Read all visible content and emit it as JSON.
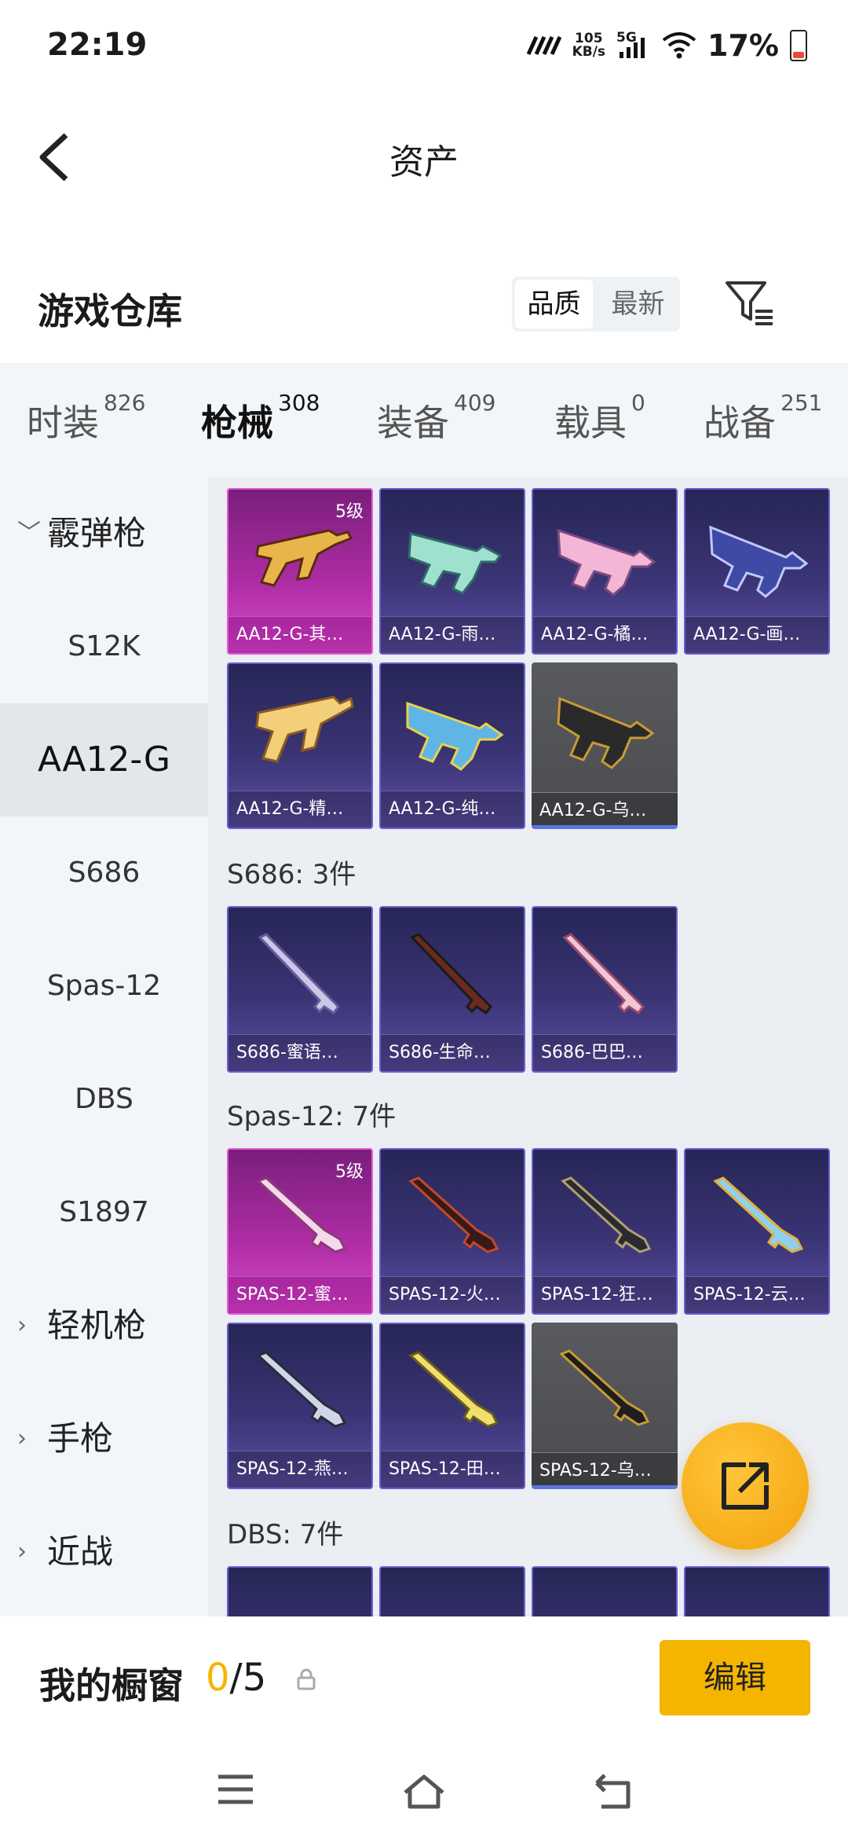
{
  "status": {
    "time": "22:19",
    "speed_value": "105",
    "speed_unit": "KB/s",
    "network": "5G",
    "battery": "17%"
  },
  "nav": {
    "title": "资产"
  },
  "warehouse": {
    "title": "游戏仓库",
    "sort_options": [
      "品质",
      "最新"
    ],
    "sort_selected": "品质"
  },
  "tabs": [
    {
      "label": "时装",
      "count": "826"
    },
    {
      "label": "枪械",
      "count": "308",
      "active": true
    },
    {
      "label": "装备",
      "count": "409"
    },
    {
      "label": "载具",
      "count": "0"
    },
    {
      "label": "战备",
      "count": "251"
    }
  ],
  "sidebar": {
    "groups": [
      "霰弹枪",
      "轻机枪",
      "手枪",
      "近战"
    ],
    "items": [
      "S12K",
      "AA12-G",
      "S686",
      "Spas-12",
      "DBS",
      "S1897"
    ],
    "selected": "AA12-G"
  },
  "sections": {
    "aa12": {
      "cards": [
        {
          "name": "AA12-G-其…",
          "level": "5级",
          "rarity": "legend"
        },
        {
          "name": "AA12-G-雨…",
          "rarity": "epic"
        },
        {
          "name": "AA12-G-橘…",
          "rarity": "epic"
        },
        {
          "name": "AA12-G-画…",
          "rarity": "epic"
        },
        {
          "name": "AA12-G-精…",
          "rarity": "epic"
        },
        {
          "name": "AA12-G-纯…",
          "rarity": "epic"
        },
        {
          "name": "AA12-G-乌…",
          "rarity": "common"
        }
      ]
    },
    "s686": {
      "header": "S686: 3件",
      "cards": [
        {
          "name": "S686-蜜语…",
          "rarity": "epic"
        },
        {
          "name": "S686-生命…",
          "rarity": "epic"
        },
        {
          "name": "S686-巴巴…",
          "rarity": "epic"
        }
      ]
    },
    "spas": {
      "header": "Spas-12: 7件",
      "cards": [
        {
          "name": "SPAS-12-蜜…",
          "level": "5级",
          "rarity": "legend"
        },
        {
          "name": "SPAS-12-火…",
          "rarity": "epic"
        },
        {
          "name": "SPAS-12-狂…",
          "rarity": "epic"
        },
        {
          "name": "SPAS-12-云…",
          "rarity": "epic"
        },
        {
          "name": "SPAS-12-燕…",
          "rarity": "epic"
        },
        {
          "name": "SPAS-12-田…",
          "rarity": "epic"
        },
        {
          "name": "SPAS-12-乌…",
          "rarity": "common"
        }
      ]
    },
    "dbs": {
      "header": "DBS: 7件"
    }
  },
  "bottom": {
    "title": "我的橱窗",
    "current": "0",
    "total": "/5",
    "edit": "编辑"
  },
  "icons": [
    "back-arrow-icon",
    "filter-icon",
    "share-icon",
    "lock-icon",
    "menu-icon",
    "home-icon",
    "return-icon"
  ],
  "colors": {
    "accent": "#f5b400",
    "legend": "#c335b3",
    "epic": "#4a3f8e",
    "common": "#55565a"
  }
}
